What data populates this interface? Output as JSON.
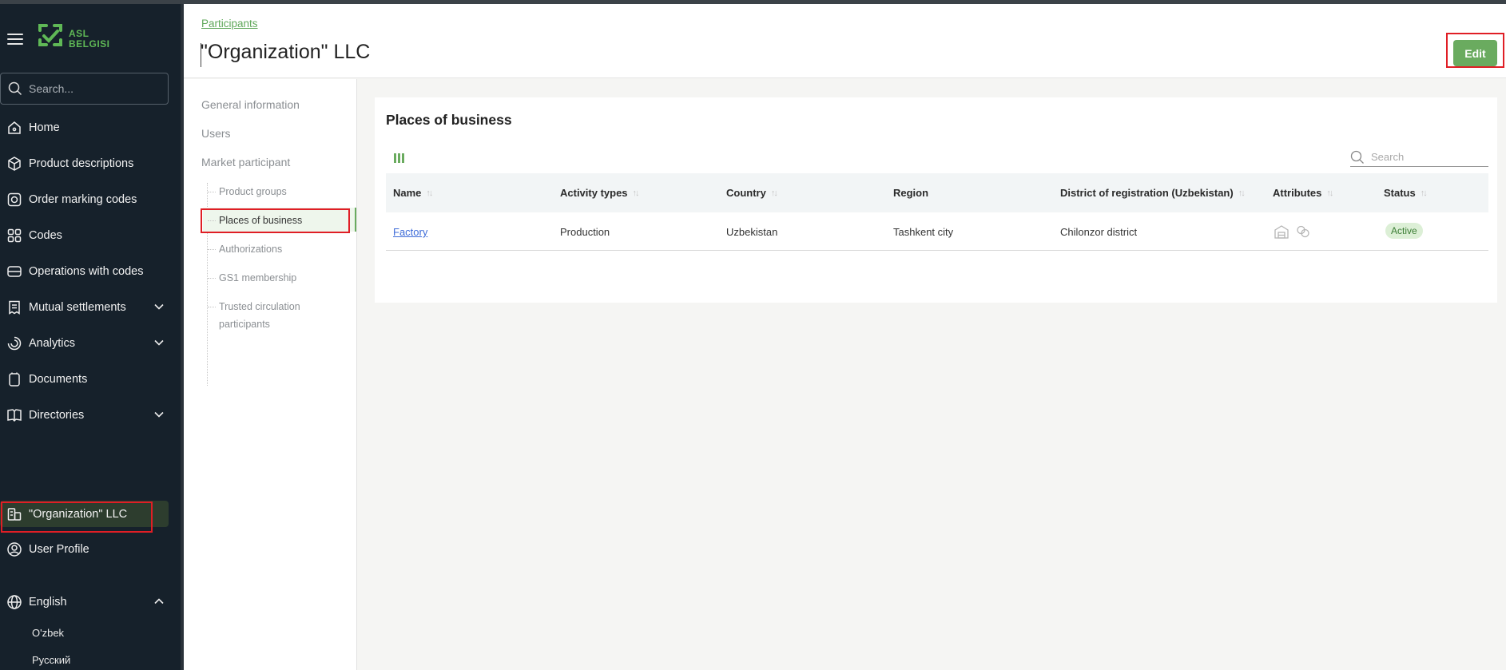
{
  "app": {
    "logo_text_line1": "ASL",
    "logo_text_line2": "BELGISI"
  },
  "sidebar": {
    "search_placeholder": "Search...",
    "items": [
      {
        "label": "Home"
      },
      {
        "label": "Product descriptions"
      },
      {
        "label": "Order marking codes"
      },
      {
        "label": "Codes"
      },
      {
        "label": "Operations with codes"
      },
      {
        "label": "Mutual settlements"
      },
      {
        "label": "Analytics"
      },
      {
        "label": "Documents"
      },
      {
        "label": "Directories"
      },
      {
        "label": "\"Organization\" LLC"
      },
      {
        "label": "User Profile"
      }
    ],
    "language": {
      "label": "English",
      "options": [
        "O'zbek",
        "Русский"
      ]
    }
  },
  "header": {
    "breadcrumb": "Participants",
    "title": "\"Organization\" LLC",
    "edit_label": "Edit"
  },
  "subnav": {
    "general": "General information",
    "users": "Users",
    "market": "Market participant",
    "children": [
      "Product groups",
      "Places of business",
      "Authorizations",
      "GS1 membership",
      "Trusted circulation",
      "participants"
    ]
  },
  "main": {
    "section_title": "Places of business",
    "search_placeholder": "Search",
    "columns": [
      "Name",
      "Activity types",
      "Country",
      "Region",
      "District of registration (Uzbekistan)",
      "Attributes",
      "Status"
    ],
    "rows": [
      {
        "name": "Factory",
        "activity": "Production",
        "country": "Uzbekistan",
        "region": "Tashkent city",
        "district": "Chilonzor district",
        "status": "Active"
      }
    ]
  },
  "colors": {
    "accent": "#6aab5f",
    "sidebar_bg": "#16212b",
    "annotation": "#e01e25"
  }
}
